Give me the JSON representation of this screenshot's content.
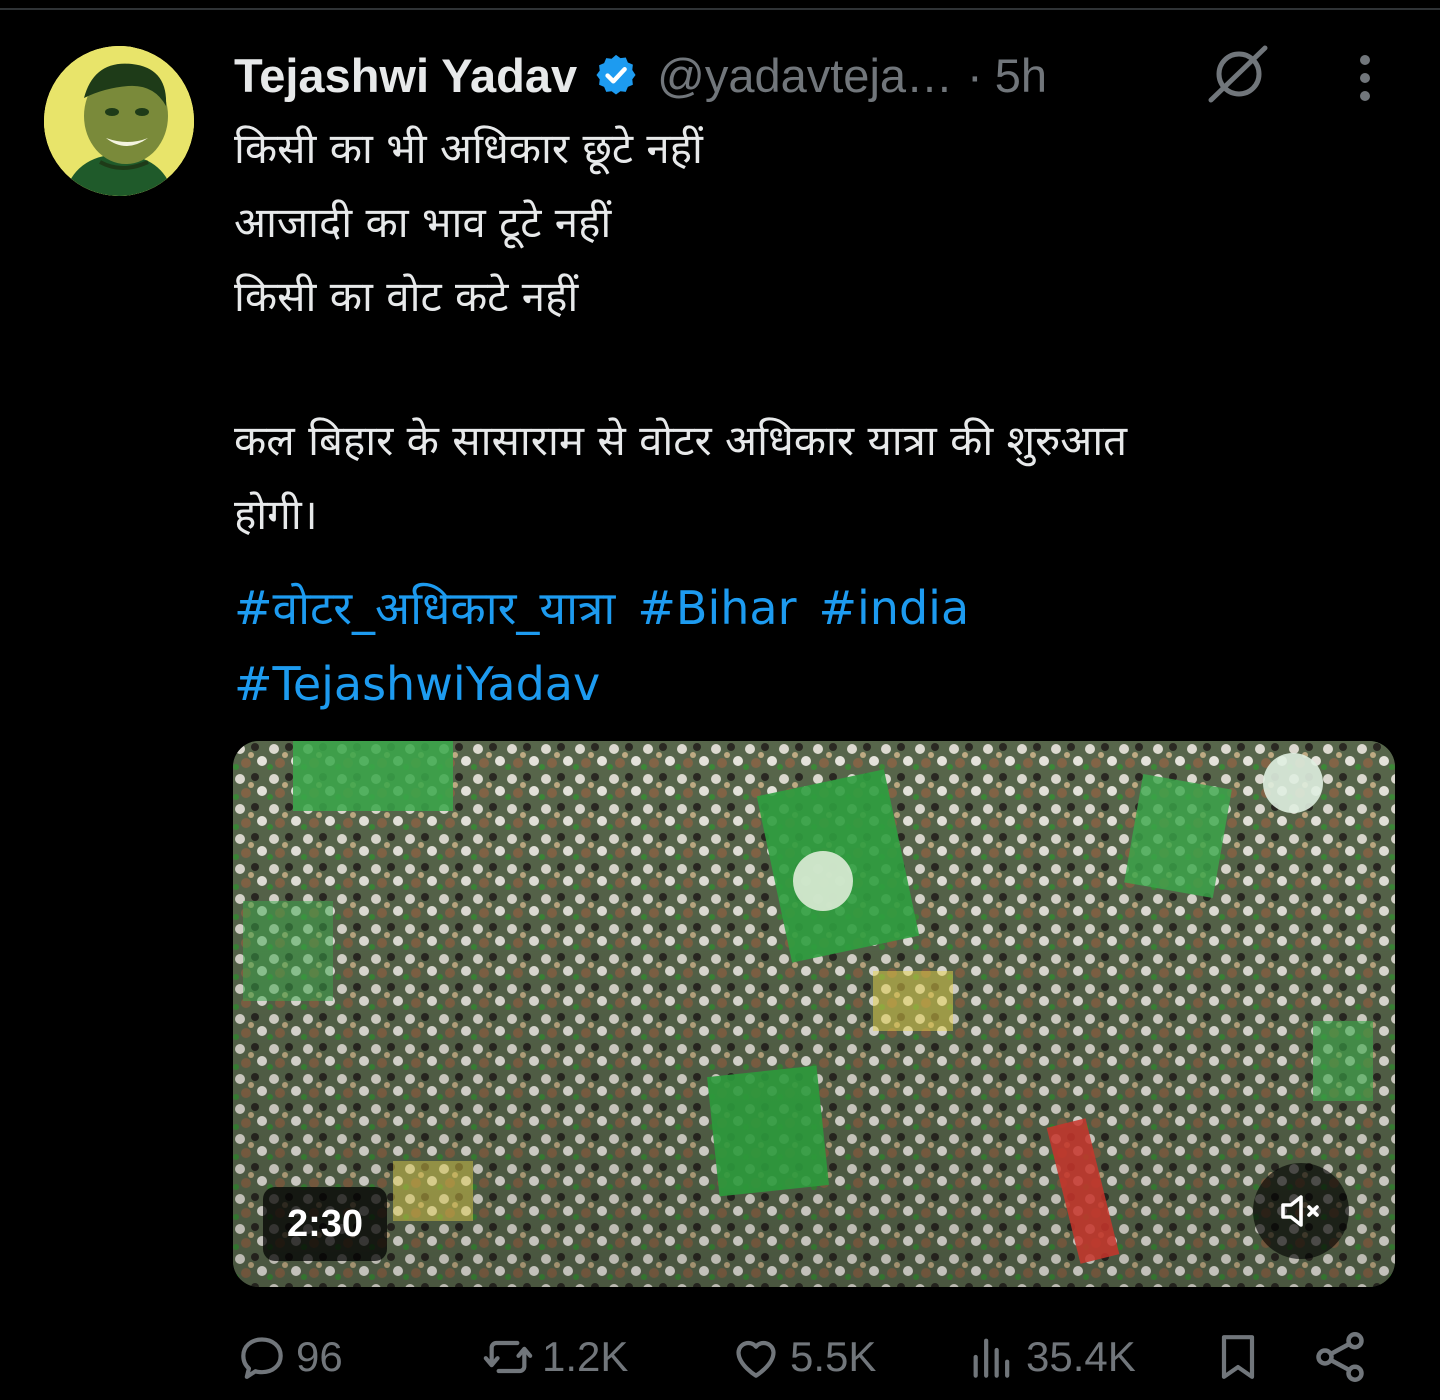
{
  "tweet": {
    "author_name": "Tejashwi Yadav",
    "handle": "@yadavteja…",
    "separator": "·",
    "time": "5h",
    "text_lines": [
      "किसी का भी अधिकार छूटे नहीं",
      "आजादी का भाव टूटे नहीं",
      "किसी का वोट कटे नहीं"
    ],
    "text_paragraph_lines": [
      "कल बिहार के सासाराम से वोटर अधिकार यात्रा की शुरुआत",
      "होगी।"
    ],
    "hashtags_row1": [
      "#वोटर_अधिकार_यात्रा",
      "#Bihar",
      "#india"
    ],
    "hashtags_row2": [
      "#TejashwiYadav"
    ]
  },
  "video": {
    "duration": "2:30",
    "muted_icon": "volume-muted-icon"
  },
  "actions": {
    "replies": "96",
    "reposts": "1.2K",
    "likes": "5.5K",
    "views": "35.4K"
  },
  "colors": {
    "background": "#000000",
    "text": "#e7e9ea",
    "muted": "#71767b",
    "link": "#1d9bf0",
    "verified": "#1d9bf0"
  },
  "icons": {
    "verified": "verified-badge-icon",
    "grok": "grok-icon",
    "more": "more-vertical-icon",
    "reply": "reply-icon",
    "repost": "repost-icon",
    "like": "heart-icon",
    "views": "views-icon",
    "bookmark": "bookmark-icon",
    "share": "share-icon"
  }
}
